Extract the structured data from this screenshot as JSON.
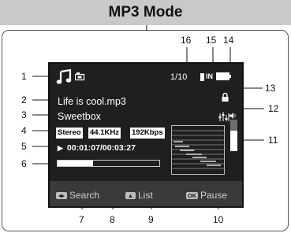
{
  "title": "MP3 Mode",
  "screen": {
    "file_count": "1/10",
    "filename": "Life is cool.mp3",
    "artist": "Sweetbox",
    "audio_mode": "Stereo",
    "sample_rate": "44.1KHz",
    "bitrate": "192Kbps",
    "elapsed_time": "00:01:07",
    "total_time": "00:03:27",
    "time_separator": "/",
    "play_symbol": "▶",
    "progress": 0.35,
    "card_label": "IN",
    "softkeys": {
      "search": "Search",
      "list": "List",
      "pause": "Pause",
      "ok_key": "OK"
    }
  },
  "callouts": {
    "left": [
      "1",
      "2",
      "3",
      "4",
      "5",
      "6"
    ],
    "top": [
      "16",
      "15",
      "14"
    ],
    "right": [
      "13",
      "12",
      "11"
    ],
    "bottom": [
      "7",
      "8",
      "9",
      "10"
    ]
  },
  "colors": {
    "screen_bg": "#1f1f1f",
    "softbar_bg": "#3a3a3a",
    "title_bar_bg": "#c9c9c9",
    "text": "#ffffff"
  }
}
